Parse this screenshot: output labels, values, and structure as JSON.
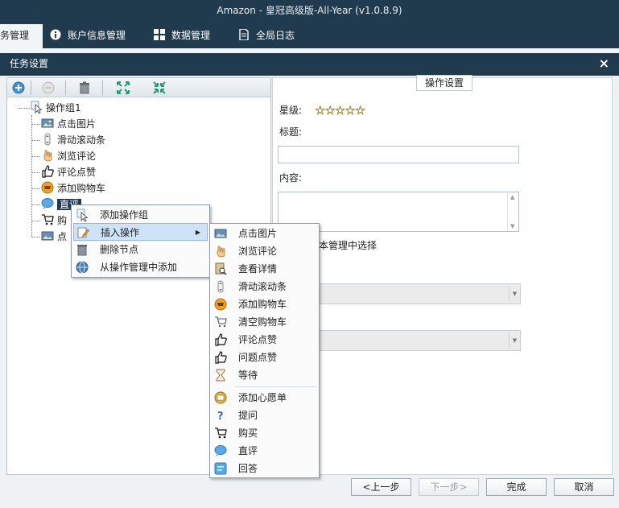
{
  "window": {
    "title": "Amazon  - 皇冠高级版-All-Year  (v1.0.8.9)"
  },
  "main_tabs": [
    {
      "label": "务管理",
      "active": true,
      "icon": "none"
    },
    {
      "label": "账户信息管理",
      "icon": "info-icon"
    },
    {
      "label": "数据管理",
      "icon": "grid-icon"
    },
    {
      "label": "全局日志",
      "icon": "document-icon"
    }
  ],
  "dialog": {
    "title": "任务设置",
    "close_glyph": "×"
  },
  "toolbar": {
    "buttons": [
      "add-icon",
      "disabled-icon",
      "trash-icon",
      "expand-icon",
      "collapse-icon"
    ]
  },
  "tree": {
    "root": {
      "label": "操作组1",
      "icon": "cursor-icon"
    },
    "children": [
      {
        "label": "点击图片",
        "icon": "picture-icon"
      },
      {
        "label": "滑动滚动条",
        "icon": "scroll-icon"
      },
      {
        "label": "浏览评论",
        "icon": "hand-icon"
      },
      {
        "label": "评论点赞",
        "icon": "thumbs-up-icon"
      },
      {
        "label": "添加购物车",
        "icon": "cart-add-icon"
      },
      {
        "label": "直评",
        "icon": "chat-bubble-icon",
        "selected": true
      },
      {
        "label": "购",
        "icon": "shopping-cart-icon"
      },
      {
        "label": "点",
        "icon": "picture-icon"
      }
    ]
  },
  "context_menu": {
    "items": [
      {
        "label": "添加操作组",
        "icon": "cursor-icon"
      },
      {
        "label": "插入操作",
        "icon": "edit-icon",
        "highlighted": true,
        "has_submenu": true
      },
      {
        "label": "删除节点",
        "icon": "trash-icon"
      },
      {
        "label": "从操作管理中添加",
        "icon": "globe-icon"
      }
    ],
    "submenu_glyph": "▶"
  },
  "submenu": {
    "items": [
      {
        "label": "点击图片",
        "icon": "picture-icon"
      },
      {
        "label": "浏览评论",
        "icon": "hand-icon"
      },
      {
        "label": "查看详情",
        "icon": "details-icon"
      },
      {
        "label": "滑动滚动条",
        "icon": "scroll-icon"
      },
      {
        "label": "添加购物车",
        "icon": "cart-add-icon"
      },
      {
        "label": "清空购物车",
        "icon": "cart-empty-icon"
      },
      {
        "label": "评论点赞",
        "icon": "thumbs-up-icon"
      },
      {
        "label": "问题点赞",
        "icon": "thumbs-up-icon"
      },
      {
        "label": "等待",
        "icon": "hourglass-icon"
      },
      {
        "label": "添加心愿单",
        "icon": "wishlist-icon"
      },
      {
        "label": "提问",
        "icon": "question-icon"
      },
      {
        "label": "购买",
        "icon": "shopping-cart-icon"
      },
      {
        "label": "直评",
        "icon": "chat-bubble-icon"
      },
      {
        "label": "回答",
        "icon": "answer-icon"
      }
    ]
  },
  "settings_panel": {
    "group_title": "操作设置",
    "rating_label": "星级:",
    "rating_stars": 5,
    "title_label": "标题:",
    "title_value": "",
    "content_label": "内容:",
    "content_value": "",
    "partial_text": "本管理中选择",
    "scroll_up_glyph": "▲",
    "scroll_down_glyph": "▼",
    "combo_arrow_glyph": "▼"
  },
  "footer": {
    "prev_label": "<上一步",
    "next_label": "下一步>",
    "finish_label": "完成",
    "cancel_label": "取消"
  },
  "colors": {
    "chrome": "#1f3b4d",
    "selection": "#1f3b4d",
    "menu_highlight": "#cfe3f7"
  }
}
